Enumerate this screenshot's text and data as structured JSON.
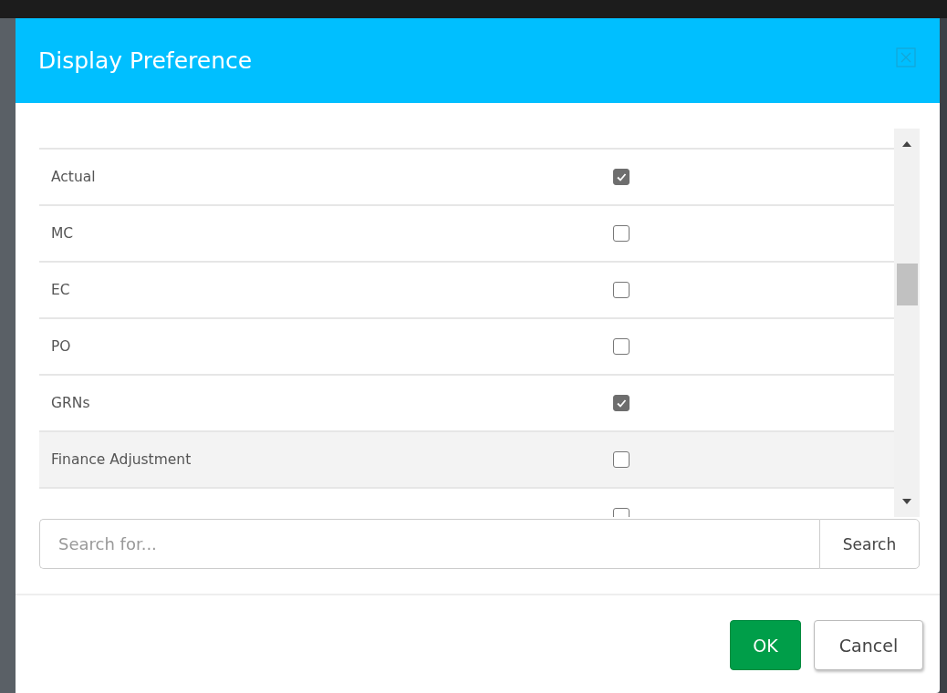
{
  "dialog": {
    "title": "Display Preference"
  },
  "items": [
    {
      "label": "Actual",
      "checked": true,
      "selected": false
    },
    {
      "label": "MC",
      "checked": false,
      "selected": false
    },
    {
      "label": "EC",
      "checked": false,
      "selected": false
    },
    {
      "label": "PO",
      "checked": false,
      "selected": false
    },
    {
      "label": "GRNs",
      "checked": true,
      "selected": false
    },
    {
      "label": "Finance Adjustment",
      "checked": false,
      "selected": true
    },
    {
      "checked": false,
      "selected": false
    }
  ],
  "search": {
    "placeholder": "Search for...",
    "button": "Search"
  },
  "buttons": {
    "ok": "OK",
    "cancel": "Cancel"
  }
}
